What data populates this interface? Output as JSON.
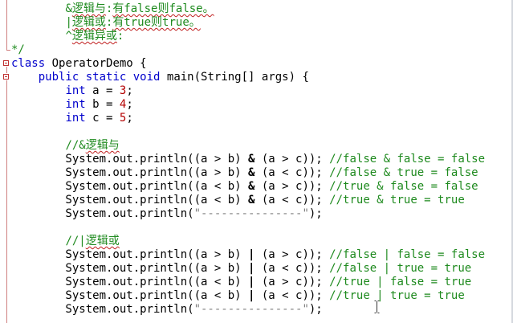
{
  "editor": {
    "lines": [
      {
        "segments": [
          {
            "t": "        ",
            "c": "txt"
          },
          {
            "t": "&",
            "c": "cm"
          },
          {
            "t": "逻辑与",
            "c": "cn"
          },
          {
            "t": ":",
            "c": "cm"
          },
          {
            "t": "有false则false。",
            "c": "cn"
          }
        ]
      },
      {
        "segments": [
          {
            "t": "        ",
            "c": "txt"
          },
          {
            "t": "|",
            "c": "cm"
          },
          {
            "t": "逻辑或",
            "c": "cn"
          },
          {
            "t": ":",
            "c": "cm"
          },
          {
            "t": "有true则true。",
            "c": "cn"
          }
        ]
      },
      {
        "segments": [
          {
            "t": "        ",
            "c": "txt"
          },
          {
            "t": "^",
            "c": "cm"
          },
          {
            "t": "逻辑异或",
            "c": "cn"
          },
          {
            "t": ":",
            "c": "cm"
          }
        ]
      },
      {
        "segments": [
          {
            "t": "*/",
            "c": "cm"
          }
        ]
      },
      {
        "segments": [
          {
            "t": "class",
            "c": "kw"
          },
          {
            "t": " OperatorDemo {",
            "c": "txt"
          }
        ]
      },
      {
        "segments": [
          {
            "t": "    ",
            "c": "txt"
          },
          {
            "t": "public",
            "c": "kw"
          },
          {
            "t": " ",
            "c": "txt"
          },
          {
            "t": "static",
            "c": "kw"
          },
          {
            "t": " ",
            "c": "txt"
          },
          {
            "t": "void",
            "c": "kw"
          },
          {
            "t": " main(String[] args) {",
            "c": "txt"
          }
        ]
      },
      {
        "segments": [
          {
            "t": "        ",
            "c": "txt"
          },
          {
            "t": "int",
            "c": "kw"
          },
          {
            "t": " a = ",
            "c": "txt"
          },
          {
            "t": "3",
            "c": "num"
          },
          {
            "t": ";",
            "c": "txt"
          }
        ]
      },
      {
        "segments": [
          {
            "t": "        ",
            "c": "txt"
          },
          {
            "t": "int",
            "c": "kw"
          },
          {
            "t": " b = ",
            "c": "txt"
          },
          {
            "t": "4",
            "c": "num"
          },
          {
            "t": ";",
            "c": "txt"
          }
        ]
      },
      {
        "segments": [
          {
            "t": "        ",
            "c": "txt"
          },
          {
            "t": "int",
            "c": "kw"
          },
          {
            "t": " c = ",
            "c": "txt"
          },
          {
            "t": "5",
            "c": "num"
          },
          {
            "t": ";",
            "c": "txt"
          }
        ]
      },
      {
        "segments": [
          {
            "t": "",
            "c": "txt"
          }
        ]
      },
      {
        "segments": [
          {
            "t": "        ",
            "c": "txt"
          },
          {
            "t": "//&",
            "c": "cm"
          },
          {
            "t": "逻辑与",
            "c": "cn"
          }
        ]
      },
      {
        "segments": [
          {
            "t": "        System.out.println((a > b) ",
            "c": "txt"
          },
          {
            "t": "&",
            "c": "op"
          },
          {
            "t": " (a > c)); ",
            "c": "txt"
          },
          {
            "t": "//false & false = false",
            "c": "cm"
          }
        ]
      },
      {
        "segments": [
          {
            "t": "        System.out.println((a > b) ",
            "c": "txt"
          },
          {
            "t": "&",
            "c": "op"
          },
          {
            "t": " (a < c)); ",
            "c": "txt"
          },
          {
            "t": "//false & true = false",
            "c": "cm"
          }
        ]
      },
      {
        "segments": [
          {
            "t": "        System.out.println((a < b) ",
            "c": "txt"
          },
          {
            "t": "&",
            "c": "op"
          },
          {
            "t": " (a > c)); ",
            "c": "txt"
          },
          {
            "t": "//true & false = false",
            "c": "cm"
          }
        ]
      },
      {
        "segments": [
          {
            "t": "        System.out.println((a < b) ",
            "c": "txt"
          },
          {
            "t": "&",
            "c": "op"
          },
          {
            "t": " (a < c)); ",
            "c": "txt"
          },
          {
            "t": "//true & true = true",
            "c": "cm"
          }
        ]
      },
      {
        "segments": [
          {
            "t": "        System.out.println(",
            "c": "txt"
          },
          {
            "t": "\"---------------\"",
            "c": "str"
          },
          {
            "t": ");",
            "c": "txt"
          }
        ]
      },
      {
        "segments": [
          {
            "t": "",
            "c": "txt"
          }
        ]
      },
      {
        "segments": [
          {
            "t": "        ",
            "c": "txt"
          },
          {
            "t": "//|",
            "c": "cm"
          },
          {
            "t": "逻辑或",
            "c": "cn"
          }
        ]
      },
      {
        "segments": [
          {
            "t": "        System.out.println((a > b) ",
            "c": "txt"
          },
          {
            "t": "|",
            "c": "op"
          },
          {
            "t": " (a > c)); ",
            "c": "txt"
          },
          {
            "t": "//false | false = false",
            "c": "cm"
          }
        ]
      },
      {
        "segments": [
          {
            "t": "        System.out.println((a > b) ",
            "c": "txt"
          },
          {
            "t": "|",
            "c": "op"
          },
          {
            "t": " (a < c)); ",
            "c": "txt"
          },
          {
            "t": "//false | true = true",
            "c": "cm"
          }
        ]
      },
      {
        "segments": [
          {
            "t": "        System.out.println((a < b) ",
            "c": "txt"
          },
          {
            "t": "|",
            "c": "op"
          },
          {
            "t": " (a > c)); ",
            "c": "txt"
          },
          {
            "t": "//true | false = true",
            "c": "cm"
          }
        ]
      },
      {
        "segments": [
          {
            "t": "        System.out.println((a < b) ",
            "c": "txt"
          },
          {
            "t": "|",
            "c": "op"
          },
          {
            "t": " (a < c)); ",
            "c": "txt"
          },
          {
            "t": "//true | true = true",
            "c": "cm"
          }
        ]
      },
      {
        "segments": [
          {
            "t": "        System.out.println(",
            "c": "txt"
          },
          {
            "t": "\"---------------\"",
            "c": "str"
          },
          {
            "t": ");",
            "c": "txt"
          }
        ]
      }
    ]
  },
  "colors": {
    "keyword": "#0000cc",
    "number": "#b40000",
    "comment": "#1e8a1e",
    "string": "#808080",
    "fold_marker": "#c03030"
  },
  "icons": {
    "fold_markers": [
      "fold-collapse-icon",
      "fold-collapse-icon"
    ],
    "cursor": "text-cursor-icon"
  }
}
